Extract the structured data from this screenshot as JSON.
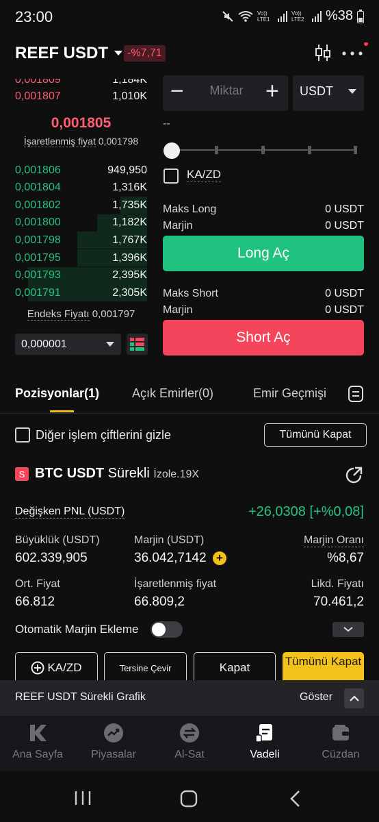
{
  "status_bar": {
    "time": "23:00",
    "lte1": "Vo)) LTE1",
    "lte2": "Vo)) LTE2",
    "battery": "%38",
    "icons": [
      "mute-icon",
      "wifi-icon",
      "signal-icon",
      "battery-icon"
    ]
  },
  "header": {
    "pair": "REEF USDT",
    "change": "-%7,71",
    "icons": [
      "candlestick-settings-icon",
      "more-icon"
    ],
    "notification_color": "#ff3b4e"
  },
  "order_book": {
    "asks": [
      {
        "price": "0,001809",
        "amount": "1,184K"
      },
      {
        "price": "0,001807",
        "amount": "1,010K"
      }
    ],
    "last_price": "0,001805",
    "mark_price_label": "İşaretlenmiş fiyat",
    "mark_price": "0,001798",
    "bids": [
      {
        "price": "0,001806",
        "amount": "949,950",
        "depth": 0
      },
      {
        "price": "0,001804",
        "amount": "1,316K",
        "depth": 0
      },
      {
        "price": "0,001802",
        "amount": "1,735K",
        "depth": 0.2
      },
      {
        "price": "0,001800",
        "amount": "1,182K",
        "depth": 0.38
      },
      {
        "price": "0,001798",
        "amount": "1,767K",
        "depth": 0.53
      },
      {
        "price": "0,001795",
        "amount": "1,396K",
        "depth": 0.53
      },
      {
        "price": "0,001793",
        "amount": "2,395K",
        "depth": 0.9
      },
      {
        "price": "0,001791",
        "amount": "2,305K",
        "depth": 0.9
      }
    ],
    "index_price_label": "Endeks Fiyatı",
    "index_price": "0,001797",
    "tick_size": "0,000001"
  },
  "order_form": {
    "qty_placeholder": "Miktar",
    "minus": "−",
    "plus": "+",
    "unit": "USDT",
    "estimate": "--",
    "kazd_label": "KA/ZD",
    "max_long_label": "Maks Long",
    "max_long_value": "0 USDT",
    "margin_label": "Marjin",
    "margin_long_value": "0 USDT",
    "long_button": "Long Aç",
    "max_short_label": "Maks Short",
    "max_short_value": "0 USDT",
    "margin_short_value": "0 USDT",
    "short_button": "Short Aç",
    "long_color": "#1fc27f",
    "short_color": "#f5455c"
  },
  "tabs": {
    "positions": "Pozisyonlar(1)",
    "open_orders": "Açık Emirler(0)",
    "order_history": "Emir Geçmişi"
  },
  "filters": {
    "hide_other_pairs": "Diğer işlem çiftlerini gizle",
    "close_all": "Tümünü Kapat"
  },
  "position": {
    "badge": "S",
    "pair": "BTC USDT",
    "type": "Sürekli",
    "mode": "İzole.19X",
    "pnl_label": "Değişken PNL (USDT)",
    "pnl_value": "+26,0308 [+%0,08]",
    "size_label": "Büyüklük (USDT)",
    "size_value": "602.339,905",
    "margin_label": "Marjin (USDT)",
    "margin_value": "36.042,7142",
    "margin_ratio_label": "Marjin Oranı",
    "margin_ratio_value": "%8,67",
    "entry_label": "Ort. Fiyat",
    "entry_value": "66.812",
    "mark_label": "İşaretlenmiş fiyat",
    "mark_value": "66.809,2",
    "liq_label": "Likd. Fiyatı",
    "liq_value": "70.461,2",
    "auto_margin_label": "Otomatik Marjin Ekleme",
    "auto_margin_on": false,
    "actions": {
      "kazd": "KA/ZD",
      "reverse": "Tersine Çevir",
      "close": "Kapat",
      "close_all": "Tümünü Kapat"
    }
  },
  "chart_bar": {
    "label": "REEF USDT Sürekli Grafik",
    "show": "Göster"
  },
  "bottom_nav": [
    {
      "label": "Ana Sayfa",
      "icon": "home-k-icon"
    },
    {
      "label": "Piyasalar",
      "icon": "markets-icon"
    },
    {
      "label": "Al-Sat",
      "icon": "trade-icon"
    },
    {
      "label": "Vadeli",
      "icon": "futures-icon",
      "active": true
    },
    {
      "label": "Cüzdan",
      "icon": "wallet-icon"
    }
  ]
}
